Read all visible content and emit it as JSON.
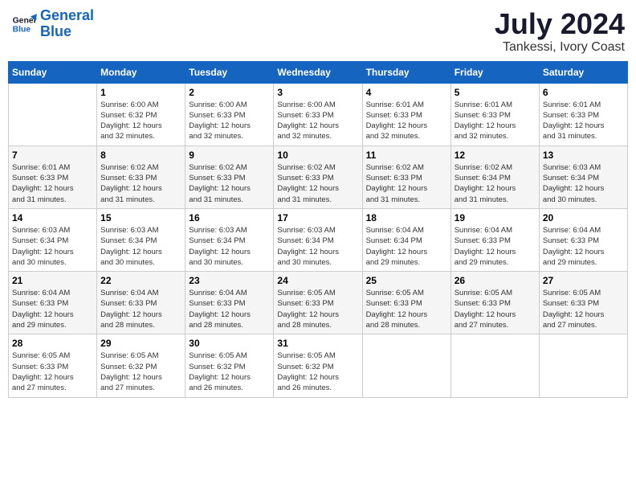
{
  "logo": {
    "line1": "General",
    "line2": "Blue"
  },
  "title": {
    "month_year": "July 2024",
    "location": "Tankessi, Ivory Coast"
  },
  "weekdays": [
    "Sunday",
    "Monday",
    "Tuesday",
    "Wednesday",
    "Thursday",
    "Friday",
    "Saturday"
  ],
  "weeks": [
    [
      {
        "day": "",
        "info": ""
      },
      {
        "day": "1",
        "info": "Sunrise: 6:00 AM\nSunset: 6:32 PM\nDaylight: 12 hours\nand 32 minutes."
      },
      {
        "day": "2",
        "info": "Sunrise: 6:00 AM\nSunset: 6:33 PM\nDaylight: 12 hours\nand 32 minutes."
      },
      {
        "day": "3",
        "info": "Sunrise: 6:00 AM\nSunset: 6:33 PM\nDaylight: 12 hours\nand 32 minutes."
      },
      {
        "day": "4",
        "info": "Sunrise: 6:01 AM\nSunset: 6:33 PM\nDaylight: 12 hours\nand 32 minutes."
      },
      {
        "day": "5",
        "info": "Sunrise: 6:01 AM\nSunset: 6:33 PM\nDaylight: 12 hours\nand 32 minutes."
      },
      {
        "day": "6",
        "info": "Sunrise: 6:01 AM\nSunset: 6:33 PM\nDaylight: 12 hours\nand 31 minutes."
      }
    ],
    [
      {
        "day": "7",
        "info": "Sunrise: 6:01 AM\nSunset: 6:33 PM\nDaylight: 12 hours\nand 31 minutes."
      },
      {
        "day": "8",
        "info": "Sunrise: 6:02 AM\nSunset: 6:33 PM\nDaylight: 12 hours\nand 31 minutes."
      },
      {
        "day": "9",
        "info": "Sunrise: 6:02 AM\nSunset: 6:33 PM\nDaylight: 12 hours\nand 31 minutes."
      },
      {
        "day": "10",
        "info": "Sunrise: 6:02 AM\nSunset: 6:33 PM\nDaylight: 12 hours\nand 31 minutes."
      },
      {
        "day": "11",
        "info": "Sunrise: 6:02 AM\nSunset: 6:33 PM\nDaylight: 12 hours\nand 31 minutes."
      },
      {
        "day": "12",
        "info": "Sunrise: 6:02 AM\nSunset: 6:34 PM\nDaylight: 12 hours\nand 31 minutes."
      },
      {
        "day": "13",
        "info": "Sunrise: 6:03 AM\nSunset: 6:34 PM\nDaylight: 12 hours\nand 30 minutes."
      }
    ],
    [
      {
        "day": "14",
        "info": "Sunrise: 6:03 AM\nSunset: 6:34 PM\nDaylight: 12 hours\nand 30 minutes."
      },
      {
        "day": "15",
        "info": "Sunrise: 6:03 AM\nSunset: 6:34 PM\nDaylight: 12 hours\nand 30 minutes."
      },
      {
        "day": "16",
        "info": "Sunrise: 6:03 AM\nSunset: 6:34 PM\nDaylight: 12 hours\nand 30 minutes."
      },
      {
        "day": "17",
        "info": "Sunrise: 6:03 AM\nSunset: 6:34 PM\nDaylight: 12 hours\nand 30 minutes."
      },
      {
        "day": "18",
        "info": "Sunrise: 6:04 AM\nSunset: 6:34 PM\nDaylight: 12 hours\nand 29 minutes."
      },
      {
        "day": "19",
        "info": "Sunrise: 6:04 AM\nSunset: 6:33 PM\nDaylight: 12 hours\nand 29 minutes."
      },
      {
        "day": "20",
        "info": "Sunrise: 6:04 AM\nSunset: 6:33 PM\nDaylight: 12 hours\nand 29 minutes."
      }
    ],
    [
      {
        "day": "21",
        "info": "Sunrise: 6:04 AM\nSunset: 6:33 PM\nDaylight: 12 hours\nand 29 minutes."
      },
      {
        "day": "22",
        "info": "Sunrise: 6:04 AM\nSunset: 6:33 PM\nDaylight: 12 hours\nand 28 minutes."
      },
      {
        "day": "23",
        "info": "Sunrise: 6:04 AM\nSunset: 6:33 PM\nDaylight: 12 hours\nand 28 minutes."
      },
      {
        "day": "24",
        "info": "Sunrise: 6:05 AM\nSunset: 6:33 PM\nDaylight: 12 hours\nand 28 minutes."
      },
      {
        "day": "25",
        "info": "Sunrise: 6:05 AM\nSunset: 6:33 PM\nDaylight: 12 hours\nand 28 minutes."
      },
      {
        "day": "26",
        "info": "Sunrise: 6:05 AM\nSunset: 6:33 PM\nDaylight: 12 hours\nand 27 minutes."
      },
      {
        "day": "27",
        "info": "Sunrise: 6:05 AM\nSunset: 6:33 PM\nDaylight: 12 hours\nand 27 minutes."
      }
    ],
    [
      {
        "day": "28",
        "info": "Sunrise: 6:05 AM\nSunset: 6:33 PM\nDaylight: 12 hours\nand 27 minutes."
      },
      {
        "day": "29",
        "info": "Sunrise: 6:05 AM\nSunset: 6:32 PM\nDaylight: 12 hours\nand 27 minutes."
      },
      {
        "day": "30",
        "info": "Sunrise: 6:05 AM\nSunset: 6:32 PM\nDaylight: 12 hours\nand 26 minutes."
      },
      {
        "day": "31",
        "info": "Sunrise: 6:05 AM\nSunset: 6:32 PM\nDaylight: 12 hours\nand 26 minutes."
      },
      {
        "day": "",
        "info": ""
      },
      {
        "day": "",
        "info": ""
      },
      {
        "day": "",
        "info": ""
      }
    ]
  ]
}
